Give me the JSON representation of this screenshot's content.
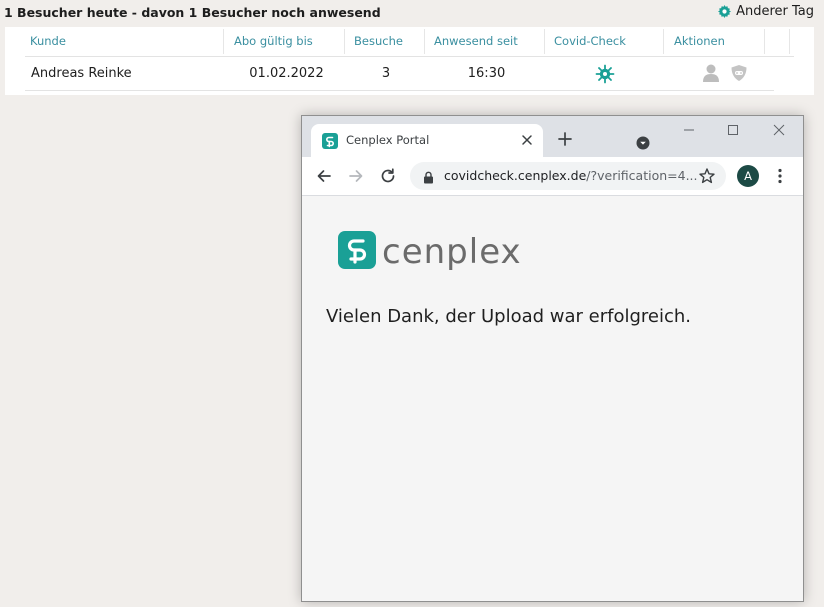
{
  "header": {
    "summary": "1 Besucher heute - davon 1 Besucher noch anwesend",
    "other_day_label": "Anderer Tag",
    "other_day_icon": "gear-icon"
  },
  "table": {
    "columns": [
      "Kunde",
      "Abo gültig bis",
      "Besuche",
      "Anwesend seit",
      "Covid-Check",
      "Aktionen"
    ],
    "rows": [
      {
        "customer": "Andreas Reinke",
        "valid_until": "01.02.2022",
        "visits": "3",
        "present_since": "16:30",
        "covid_icon": "virus-icon",
        "actions": [
          "person-icon",
          "shield-icon"
        ]
      }
    ]
  },
  "browser": {
    "tab_title": "Cenplex Portal",
    "url_host": "covidcheck.cenplex.de",
    "url_rest": "/?verification=4...",
    "profile_initial": "A",
    "accent_color": "#1aa096",
    "profile_color": "#1c4a45"
  },
  "page": {
    "logo_text": "cenplex",
    "message": "Vielen Dank, der Upload war erfolgreich."
  },
  "colors": {
    "header_link": "#3a8fa0",
    "teal": "#1aa096"
  }
}
